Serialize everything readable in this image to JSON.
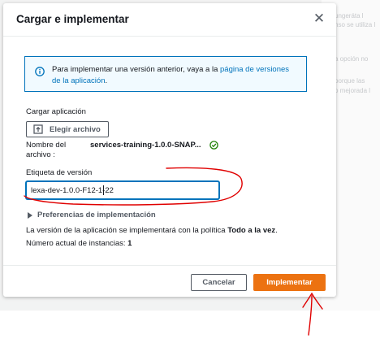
{
  "background": {
    "text_lines": [
      "ungeráta l",
      "nso se utiliza l",
      "a opción no",
      "porque las",
      "o mejorada l"
    ]
  },
  "dialog": {
    "title": "Cargar e implementar",
    "close_icon": "close-icon",
    "alert": {
      "icon": "info-icon",
      "text_before": "Para implementar una versión anterior, vaya a la ",
      "link_text": "página de versiones de la aplicación",
      "text_after": "."
    },
    "upload": {
      "section_label": "Cargar aplicación",
      "button_label": "Elegir archivo",
      "button_icon": "upload-icon",
      "file_label_line1": "Nombre del",
      "file_label_line2": "archivo :",
      "file_name": "services-training-1.0.0-SNAP...",
      "status_icon": "check-circle-icon"
    },
    "version": {
      "label": "Etiqueta de versión",
      "value": "lexa-dev-1.0.0-F12-1-22"
    },
    "preferences": {
      "label": "Preferencias de implementación",
      "icon": "caret-right-icon"
    },
    "policy": {
      "text_before": "La versión de la aplicación se implementará con la política ",
      "policy_name": "Todo a la vez",
      "text_after": "."
    },
    "instances": {
      "label": "Número actual de instancias: ",
      "count": "1"
    },
    "footer": {
      "cancel_label": "Cancelar",
      "deploy_label": "Implementar"
    }
  },
  "colors": {
    "accent_link": "#0073bb",
    "primary_button": "#ec7211",
    "success": "#1d8102",
    "annotation": "#e00000"
  }
}
